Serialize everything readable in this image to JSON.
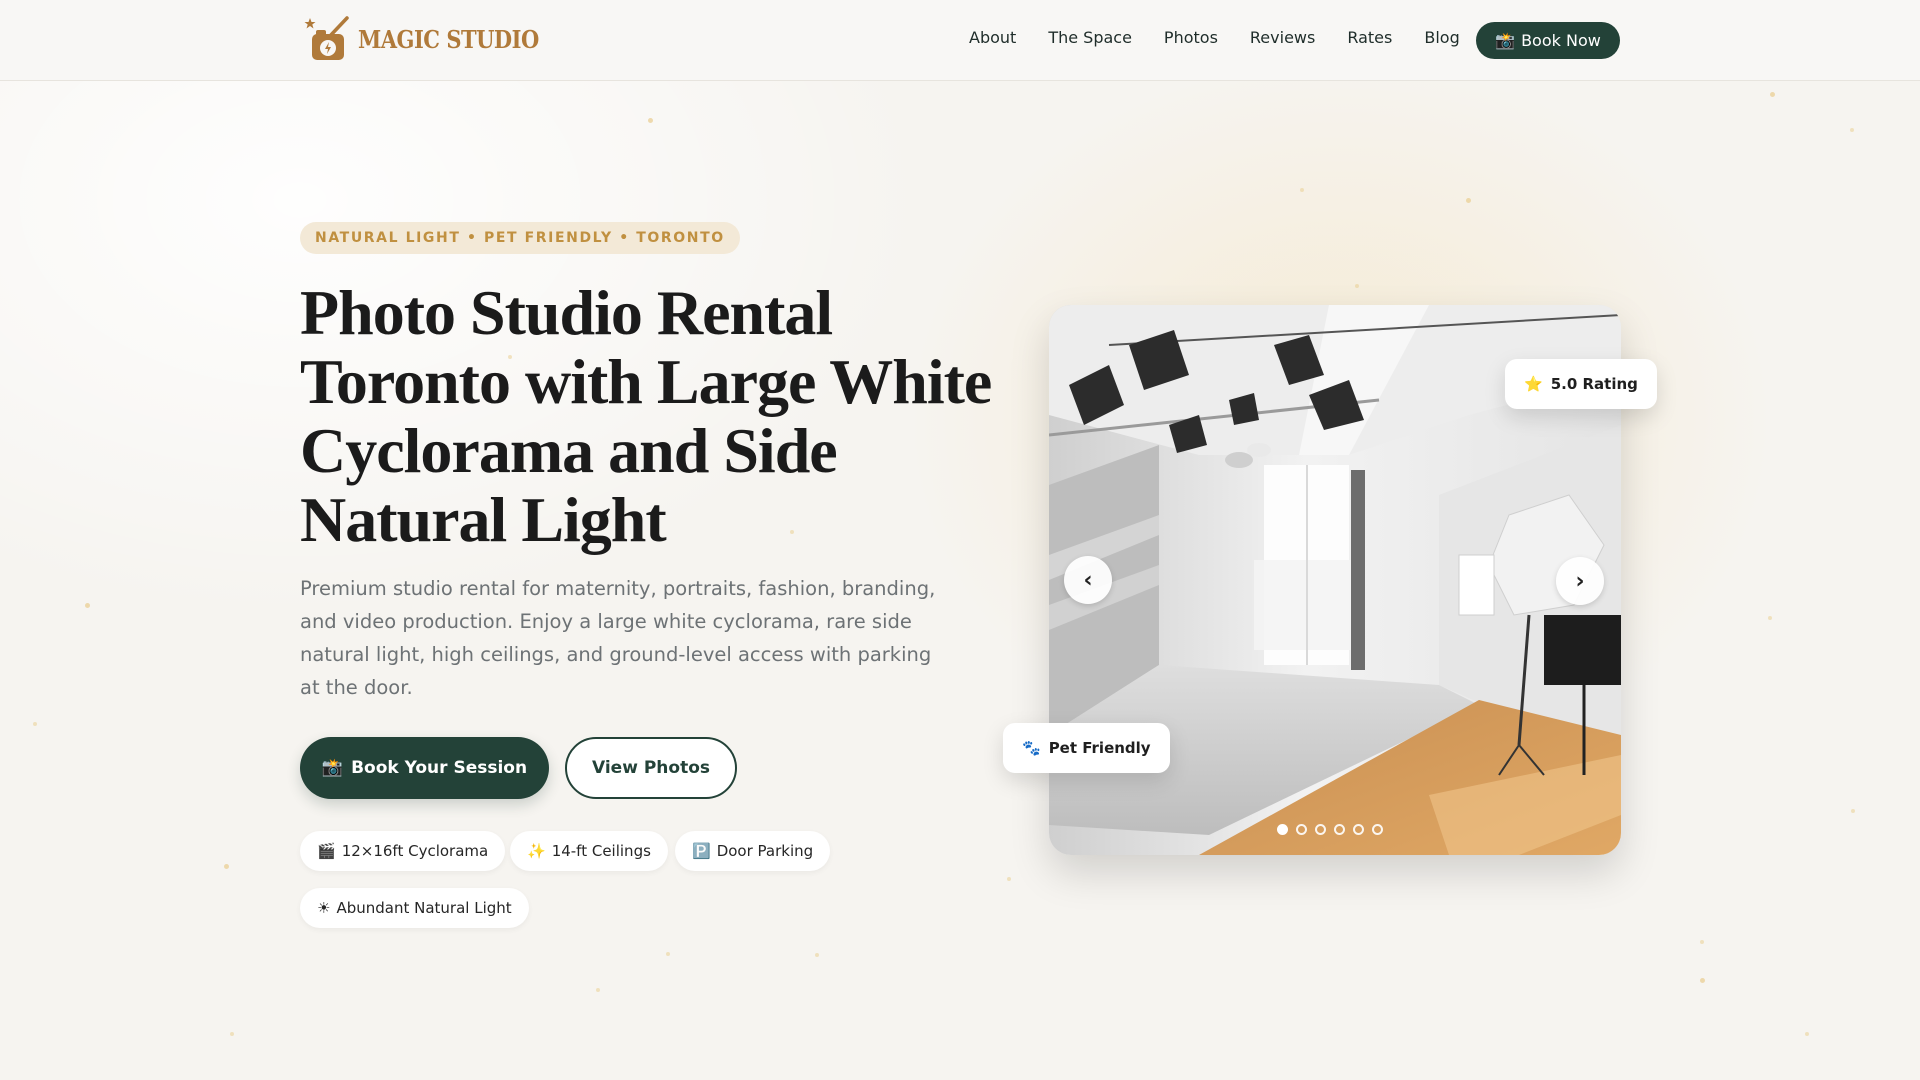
{
  "brand": {
    "logo_text": "MAGIC STUDIO",
    "accent": "#b07a3a",
    "primary": "#234238"
  },
  "nav": {
    "items": [
      "About",
      "The Space",
      "Photos",
      "Reviews",
      "Rates",
      "Blog"
    ],
    "book_icon": "📸",
    "book_label": "Book Now"
  },
  "hero": {
    "tagline": "NATURAL LIGHT • PET FRIENDLY • TORONTO",
    "title": "Photo Studio Rental Toronto with Large White Cyclorama and Side Natural Light",
    "description": "Premium studio rental for maternity, portraits, fashion, branding, and video production. Enjoy a large white cyclorama, rare side natural light, high ceilings, and ground-level access with parking at the door.",
    "primary_cta_icon": "📸",
    "primary_cta": "Book Your Session",
    "secondary_cta": "View Photos",
    "features": [
      {
        "icon": "🎬",
        "label": "12×16ft Cyclorama"
      },
      {
        "icon": "✨",
        "label": "14-ft Ceilings"
      },
      {
        "icon": "🅿️",
        "label": "Door Parking"
      },
      {
        "icon": "☀",
        "label": "Abundant Natural Light"
      }
    ]
  },
  "carousel": {
    "prev_icon": "‹",
    "next_icon": "›",
    "slide_count": 6,
    "active_slide": 1,
    "rating_icon": "⭐",
    "rating_label": "5.0 Rating",
    "pet_icon": "🐾",
    "pet_label": "Pet Friendly"
  }
}
